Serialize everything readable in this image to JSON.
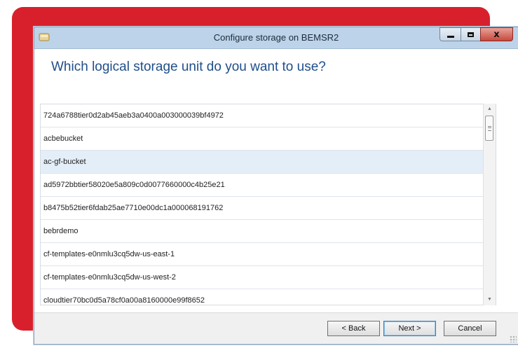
{
  "window": {
    "title": "Configure storage on BEMSR2",
    "minimize_icon": "minimize-icon",
    "maximize_icon": "maximize-icon",
    "close_icon": "close-icon",
    "close_glyph": "x"
  },
  "page": {
    "heading": "Which logical storage unit do you want to use?"
  },
  "storage_list": {
    "items": [
      "724a6788tier0d2ab45aeb3a0400a003000039bf4972",
      "acbebucket",
      "ac-gf-bucket",
      "ad5972bbtier58020e5a809c0d0077660000c4b25e21",
      "b8475b52tier6fdab25ae7710e00dc1a000068191762",
      "bebrdemo",
      "cf-templates-e0nmlu3cq5dw-us-east-1",
      "cf-templates-e0nmlu3cq5dw-us-west-2",
      "cloudtier70bc0d5a78cf0a00a8160000e99f8652"
    ],
    "selected_index": 2
  },
  "buttons": {
    "back": "< Back",
    "next": "Next >",
    "cancel": "Cancel"
  },
  "colors": {
    "backdrop": "#d8202c",
    "heading": "#1f4e8a",
    "selection": "#e4eef8"
  }
}
